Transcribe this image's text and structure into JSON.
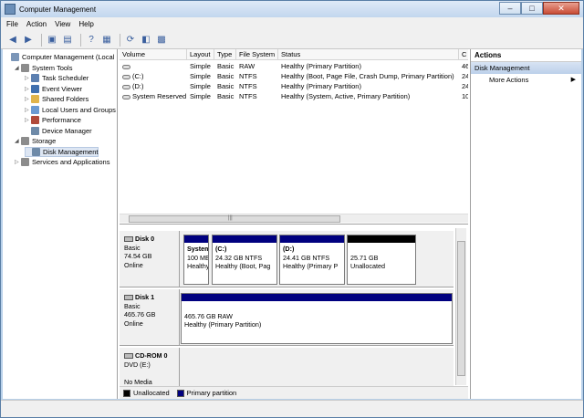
{
  "window": {
    "title": "Computer Management"
  },
  "caption": {
    "min": "–",
    "max": "□",
    "close": "✕"
  },
  "menus": [
    "File",
    "Action",
    "View",
    "Help"
  ],
  "tree": [
    {
      "label": "Computer Management (Local",
      "level": 0,
      "exp": "",
      "color": "#7b96b8"
    },
    {
      "label": "System Tools",
      "level": 1,
      "exp": "◢",
      "color": "#8c8c8c"
    },
    {
      "label": "Task Scheduler",
      "level": 2,
      "exp": "▷",
      "color": "#5b7fb0"
    },
    {
      "label": "Event Viewer",
      "level": 2,
      "exp": "▷",
      "color": "#3f6fae"
    },
    {
      "label": "Shared Folders",
      "level": 2,
      "exp": "▷",
      "color": "#e0b44c"
    },
    {
      "label": "Local Users and Groups",
      "level": 2,
      "exp": "▷",
      "color": "#6b9ad2"
    },
    {
      "label": "Performance",
      "level": 2,
      "exp": "▷",
      "color": "#b04a3a"
    },
    {
      "label": "Device Manager",
      "level": 2,
      "exp": "",
      "color": "#6e8aa8"
    },
    {
      "label": "Storage",
      "level": 1,
      "exp": "◢",
      "color": "#8c8c8c"
    },
    {
      "label": "Disk Management",
      "level": 2,
      "exp": "",
      "color": "#6e8aa8",
      "selected": true
    },
    {
      "label": "Services and Applications",
      "level": 1,
      "exp": "▷",
      "color": "#8c8c8c"
    }
  ],
  "volumes": {
    "columns": [
      "Volume",
      "Layout",
      "Type",
      "File System",
      "Status",
      "C"
    ],
    "rows": [
      [
        "",
        "Simple",
        "Basic",
        "RAW",
        "Healthy (Primary Partition)",
        "46"
      ],
      [
        "(C:)",
        "Simple",
        "Basic",
        "NTFS",
        "Healthy (Boot, Page File, Crash Dump, Primary Partition)",
        "24"
      ],
      [
        "(D:)",
        "Simple",
        "Basic",
        "NTFS",
        "Healthy (Primary Partition)",
        "24"
      ],
      [
        "System Reserved",
        "Simple",
        "Basic",
        "NTFS",
        "Healthy (System, Active, Primary Partition)",
        "10"
      ]
    ],
    "scroll_arrow": "|||"
  },
  "disks": [
    {
      "name": "Disk 0",
      "lines": [
        "Basic",
        "74.54 GB",
        "Online"
      ],
      "parts": [
        {
          "title": "System",
          "lines": [
            "100 ME",
            "Healthy"
          ],
          "unalloc": false
        },
        {
          "title": "(C:)",
          "lines": [
            "24.32 GB NTFS",
            "Healthy (Boot, Pag"
          ],
          "unalloc": false
        },
        {
          "title": "(D:)",
          "lines": [
            "24.41 GB NTFS",
            "Healthy (Primary P"
          ],
          "unalloc": false
        },
        {
          "title": "",
          "lines": [
            "25.71 GB",
            "Unallocated"
          ],
          "unalloc": true
        }
      ]
    },
    {
      "name": "Disk 1",
      "lines": [
        "Basic",
        "465.76 GB",
        "Online"
      ],
      "parts": [
        {
          "title": "",
          "lines": [
            "465.76 GB RAW",
            "Healthy (Primary Partition)"
          ],
          "unalloc": false
        }
      ]
    },
    {
      "name": "CD-ROM 0",
      "lines": [
        "DVD (E:)",
        "",
        "No Media"
      ],
      "parts": []
    }
  ],
  "legend": [
    {
      "label": "Unallocated",
      "color": "#000000"
    },
    {
      "label": "Primary partition",
      "color": "#00007f"
    }
  ],
  "actions": {
    "header": "Actions",
    "section": "Disk Management",
    "items": [
      {
        "label": "More Actions",
        "arrow": "▶"
      }
    ]
  }
}
